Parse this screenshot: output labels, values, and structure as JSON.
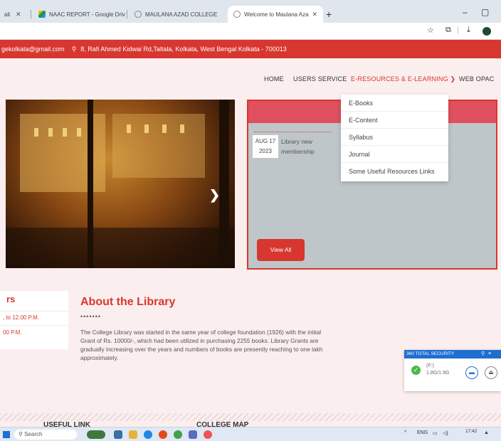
{
  "browser": {
    "tabs": [
      {
        "label": "ali",
        "active": false
      },
      {
        "label": "NAAC REPORT - Google Drive",
        "active": false
      },
      {
        "label": "MAULANA AZAD COLLEGE",
        "active": false
      },
      {
        "label": "Welcome to Maulana Azad Coll",
        "active": true
      }
    ],
    "new_tab": "+",
    "minimize": "–",
    "restore": "▢"
  },
  "info_bar": {
    "email": "gekolkata@gmail.com",
    "address": "8, Rafi Ahmed Kidwai Rd,Taltala, Kolkata, West Bengal Kolkata - 700013"
  },
  "nav": {
    "items": [
      {
        "label": "HOME"
      },
      {
        "label": "USERS SERVICE"
      },
      {
        "label": "E-RESOURCES & E-LEARNING ❯"
      },
      {
        "label": "WEB OPAC"
      }
    ],
    "dropdown": [
      "E-Books",
      "E-Content",
      "Syllabus",
      "Journal",
      "Some Useful Resources Links"
    ]
  },
  "notice": {
    "date_line1": "AUG 17",
    "date_line2": "2023",
    "text": "Library new membership",
    "view_all": "View All"
  },
  "hours": {
    "title": "rs",
    "line1": ", to 12.00 P.M.",
    "line2": "00 P.M."
  },
  "about": {
    "title": "About the Library",
    "dots": "•••••••",
    "body": "The College Library was started in the same year of college foundation (1926) with the initial Grant of Rs. 10000/-, which had been utilized in purchasing 2255 books. Library Grants are gradually increasing over the years and numbers of books are presently reaching to one lakh approximately."
  },
  "security_popup": {
    "title": "360 TOTAL SECURITY",
    "drive": "(F:)",
    "size": "1.8G/1.9G"
  },
  "footer": {
    "useful_link": "USEFUL LINK",
    "college_map": "COLLEGE MAP"
  },
  "taskbar": {
    "search": "Search",
    "lang": "ENG",
    "time": "17:42",
    "date": "",
    "caret": "^"
  },
  "colors": {
    "accent": "#d7372f",
    "page_bg": "#fbeeee",
    "notice_bg": "#bfc6c9"
  }
}
